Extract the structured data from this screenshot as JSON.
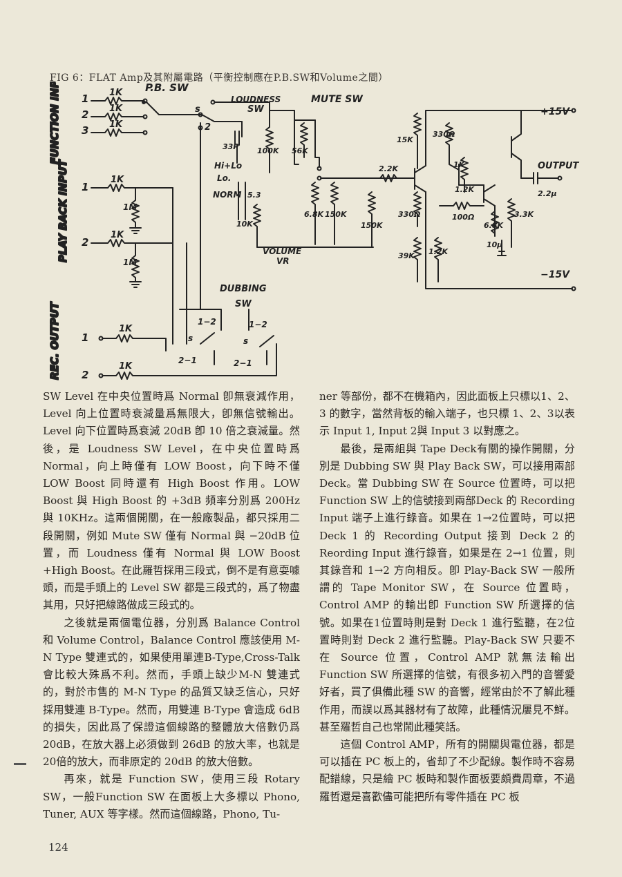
{
  "figure": {
    "caption": "FIG 6：FLAT Amp及其附屬電路（平衡控制應在P.B.SW和Volume之間）",
    "labels": {
      "function_input": "FUNCTION INPUT",
      "play_back_input": "PLAY BACK INPUT",
      "rec_output": "REC. OUTPUT",
      "pb_sw": "P.B. SW",
      "loudness": "LOUDNESS",
      "sw": "SW",
      "mute_sw": "MUTE SW",
      "dubbing": "DUBBING",
      "volume": "VOLUME",
      "vr": "VR",
      "output": "OUTPUT",
      "plus15": "+15V",
      "minus15": "−15V",
      "hilo": "Hi+Lo",
      "lo": "Lo.",
      "norm": "NORM",
      "n1": "1",
      "n2": "2",
      "n3": "3",
      "s": "s",
      "one_two": "1−2",
      "two_one": "2−1",
      "r1k": "1K",
      "r1m": "1M",
      "r15k": "15K",
      "r330a": "330Ω",
      "r1ka": "1K",
      "r56k": "56K",
      "r100k": "100K",
      "c33": "33P",
      "r2_2k": "2.2K",
      "r68k": "6.8K",
      "r150k": "150K",
      "r10k": "10K",
      "r330b": "330Ω",
      "r12k": "1.2K",
      "r100": "100Ω",
      "r3_3k": "3.3K",
      "r39k": "39K",
      "r6_8k": "6.8K",
      "c2_2": "2.2μ",
      "c10": "10μ",
      "c53": "5.3"
    }
  },
  "body": {
    "left": [
      "SW Level 在中央位置時爲 Normal 卽無衰減作用，Level 向上位置時衰減量爲無限大，卽無信號輸出。Level 向下位置時爲衰減 20dB 卽 10 倍之衰減量。然後，是 Loudness SW Level，在中央位置時爲 Normal，向上時僅有 LOW Boost，向下時不僅 LOW Boost 同時還有 High Boost 作用。LOW Boost 與 High Boost 的 +3dB 頻率分別爲 200Hz 與 10KHz。這兩個開關，在一般廠製品，都只採用二段開關，例如 Mute SW 僅有 Normal 與 −20dB 位置，而 Loudness 僅有 Normal 與 LOW Boost +High Boost。在此羅哲採用三段式，倒不是有意耍噱頭，而是手頭上的 Level SW 都是三段式的，爲了物盡其用，只好把線路做成三段式的。",
      "之後就是兩個電位器，分別爲 Balance Control 和 Volume Control，Balance Control 應該使用 M-N Type 雙連式的，如果使用單連B-Type,Cross-Talk會比較大殊爲不利。然而，手頭上缺少M-N 雙連式的，對於市售的 M-N Type 的品質又缺乏信心，只好採用雙連 B-Type。然而，用雙連 B-Type 會造成 6dB 的損失，因此爲了保證這個線路的整體放大倍數仍爲 20dB，在放大器上必須做到 26dB 的放大率，也就是20倍的放大，而非原定的 20dB 的放大倍數。",
      "再來，就是 Function SW，使用三段 Rotary SW，一般Function SW 在面板上大多標以 Phono, Tuner, AUX 等字樣。然而這個線路，Phono, Tu-"
    ],
    "right": [
      "ner 等部份，都不在機箱內，因此面板上只標以1、2、3 的數字，當然背板的輸入端子，也只標 1、2、3以表示 Input 1, Input 2與 Input 3 以對應之。",
      "最後，是兩組與 Tape Deck有關的操作開關，分別是 Dubbing SW 與 Play Back SW，可以接用兩部 Deck。當 Dubbing SW 在 Source 位置時，可以把 Function SW 上的信號接到兩部Deck 的 Recording Input 端子上進行錄音。如果在 1→2位置時，可以把 Deck 1 的 Recording Output 接到 Deck 2 的 Reording Input 進行錄音，如果是在 2→1 位置，則其錄音和 1→2 方向相反。卽 Play-Back SW 一般所謂的 Tape Monitor SW，在 Source 位置時，Control AMP 的輸出卽 Function SW 所選擇的信號。如果在1位置時則是對 Deck 1 進行監聽，在2位置時則對 Deck 2 進行監聽。Play-Back SW 只要不在 Source 位置，Control AMP 就無法輸出 Function SW 所選擇的信號，有很多初入門的音響愛好者，買了俱備此種 SW 的音響，經常由於不了解此種作用，而誤以爲其器材有了故障，此種情況屢見不鮮。甚至羅哲自己也常鬧此種笑話。",
      "這個 Control AMP，所有的開關與電位器，都是可以插在 PC 板上的，省却了不少配線。製作時不容易配錯線，只是繪 PC 板時和製作面板要頗費周章，不過羅哲還是喜歡儘可能把所有零件插在 PC 板"
    ]
  },
  "page_number": "124"
}
